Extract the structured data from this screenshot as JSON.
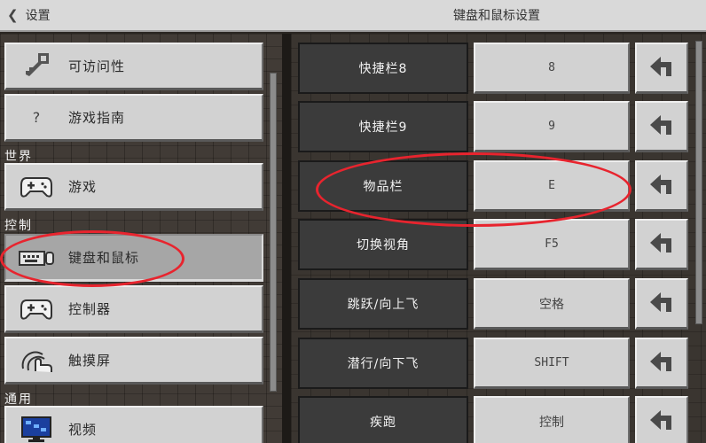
{
  "topbar": {
    "back_label": "设置",
    "title": "键盘和鼠标设置"
  },
  "sidebar": {
    "items_top": [
      {
        "label": "可访问性",
        "icon": "key-icon"
      },
      {
        "label": "游戏指南",
        "icon": "question-mark-icon"
      }
    ],
    "section_world": "世界",
    "items_world": [
      {
        "label": "游戏",
        "icon": "gamepad-icon"
      }
    ],
    "section_controls": "控制",
    "items_controls": [
      {
        "label": "键盘和鼠标",
        "icon": "keyboard-mouse-icon",
        "selected": true
      },
      {
        "label": "控制器",
        "icon": "gamepad-icon"
      },
      {
        "label": "触摸屏",
        "icon": "touch-hand-icon"
      }
    ],
    "section_general": "通用",
    "items_general": [
      {
        "label": "视频",
        "icon": "monitor-icon"
      }
    ]
  },
  "bindings": [
    {
      "action": "快捷栏8",
      "key": "8"
    },
    {
      "action": "快捷栏9",
      "key": "9"
    },
    {
      "action": "物品栏",
      "key": "E",
      "highlighted": true
    },
    {
      "action": "切换视角",
      "key": "F5"
    },
    {
      "action": "跳跃/向上飞",
      "key": "空格"
    },
    {
      "action": "潜行/向下飞",
      "key": "SHIFT"
    },
    {
      "action": "疾跑",
      "key": "控制"
    }
  ],
  "colors": {
    "button_face": "#d2d2d2",
    "button_selected": "#a6a6a6",
    "dark_label": "#3b3b3b",
    "annotation_red": "#e8242e",
    "background_dirt": "#413b36"
  }
}
